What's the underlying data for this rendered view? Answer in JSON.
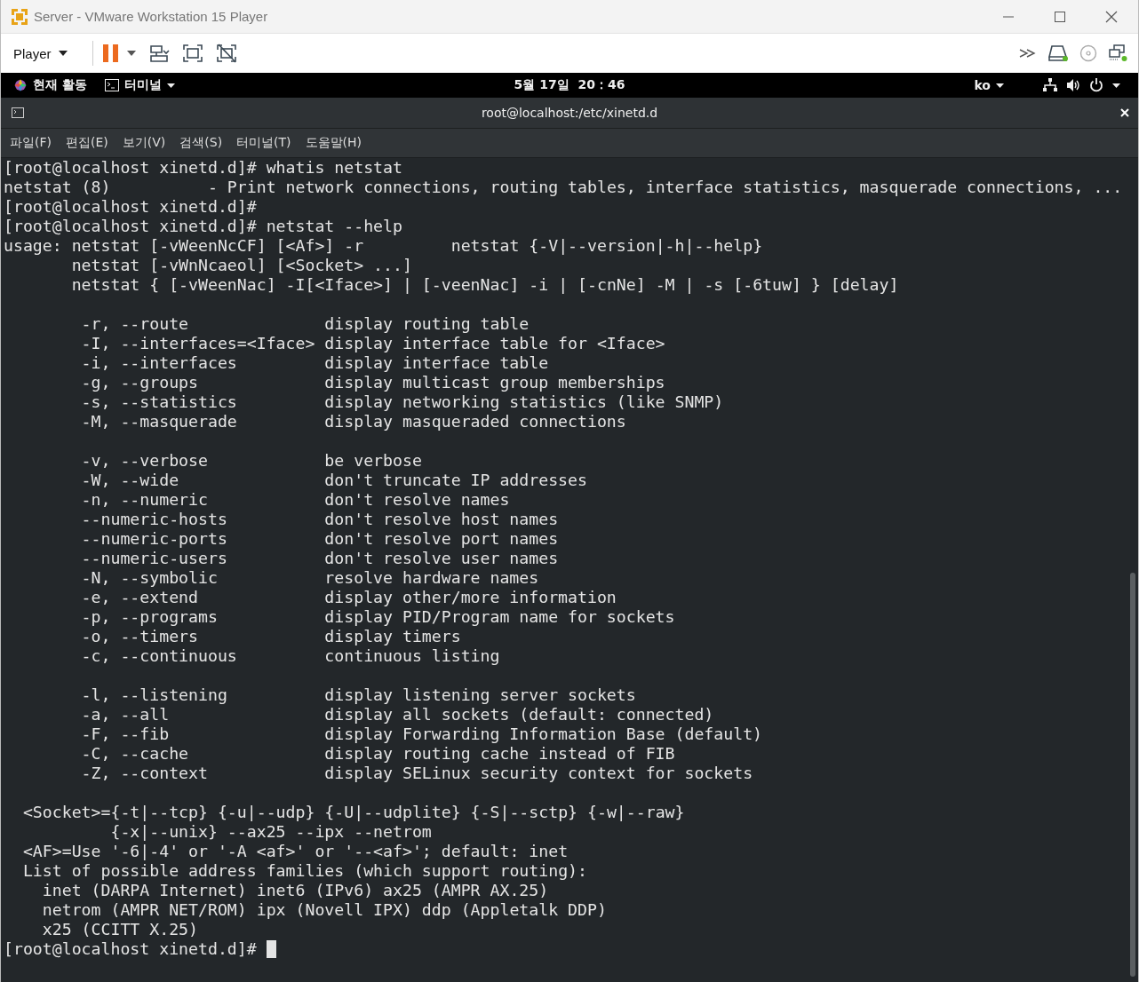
{
  "window": {
    "title": "Server - VMware Workstation 15 Player"
  },
  "toolbar": {
    "menu_label": "Player"
  },
  "top_bar": {
    "activities": "현재 활동",
    "app_menu": "터미널",
    "clock": "5월 17일  20：46",
    "input_method": "ko"
  },
  "terminal": {
    "title": "root@localhost:/etc/xinetd.d",
    "menu": [
      "파일(F)",
      "편집(E)",
      "보기(V)",
      "검색(S)",
      "터미널(T)",
      "도움말(H)"
    ],
    "blocks": [
      {
        "kind": "text",
        "lines": [
          "[root@localhost xinetd.d]# whatis netstat",
          "netstat (8)          - Print network connections, routing tables, interface statistics, masquerade connections, ...",
          "[root@localhost xinetd.d]#",
          "[root@localhost xinetd.d]# netstat --help",
          "usage: netstat [-vWeenNcCF] [<Af>] -r         netstat {-V|--version|-h|--help}",
          "       netstat [-vWnNcaeol] [<Socket> ...]",
          "       netstat { [-vWeenNac] -I[<Iface>] | [-veenNac] -i | [-cnNe] -M | -s [-6tuw] } [delay]"
        ]
      },
      {
        "kind": "options",
        "rows": [
          {
            "flag": "-r, --route",
            "desc": "display routing table"
          },
          {
            "flag": "-I, --interfaces=<Iface>",
            "desc": "display interface table for <Iface>"
          },
          {
            "flag": "-i, --interfaces",
            "desc": "display interface table"
          },
          {
            "flag": "-g, --groups",
            "desc": "display multicast group memberships"
          },
          {
            "flag": "-s, --statistics",
            "desc": "display networking statistics (like SNMP)"
          },
          {
            "flag": "-M, --masquerade",
            "desc": "display masqueraded connections"
          }
        ]
      },
      {
        "kind": "options",
        "rows": [
          {
            "flag": "-v, --verbose",
            "desc": "be verbose"
          },
          {
            "flag": "-W, --wide",
            "desc": "don't truncate IP addresses"
          },
          {
            "flag": "-n, --numeric",
            "desc": "don't resolve names"
          },
          {
            "flag": "--numeric-hosts",
            "desc": "don't resolve host names"
          },
          {
            "flag": "--numeric-ports",
            "desc": "don't resolve port names"
          },
          {
            "flag": "--numeric-users",
            "desc": "don't resolve user names"
          },
          {
            "flag": "-N, --symbolic",
            "desc": "resolve hardware names"
          },
          {
            "flag": "-e, --extend",
            "desc": "display other/more information"
          },
          {
            "flag": "-p, --programs",
            "desc": "display PID/Program name for sockets"
          },
          {
            "flag": "-o, --timers",
            "desc": "display timers"
          },
          {
            "flag": "-c, --continuous",
            "desc": "continuous listing"
          }
        ]
      },
      {
        "kind": "options",
        "rows": [
          {
            "flag": "-l, --listening",
            "desc": "display listening server sockets"
          },
          {
            "flag": "-a, --all",
            "desc": "display all sockets (default: connected)"
          },
          {
            "flag": "-F, --fib",
            "desc": "display Forwarding Information Base (default)"
          },
          {
            "flag": "-C, --cache",
            "desc": "display routing cache instead of FIB"
          },
          {
            "flag": "-Z, --context",
            "desc": "display SELinux security context for sockets"
          }
        ]
      },
      {
        "kind": "text",
        "lines": [
          "  <Socket>={-t|--tcp} {-u|--udp} {-U|--udplite} {-S|--sctp} {-w|--raw}",
          "           {-x|--unix} --ax25 --ipx --netrom",
          "  <AF>=Use '-6|-4' or '-A <af>' or '--<af>'; default: inet",
          "  List of possible address families (which support routing):",
          "    inet (DARPA Internet) inet6 (IPv6) ax25 (AMPR AX.25)",
          "    netrom (AMPR NET/ROM) ipx (Novell IPX) ddp (Appletalk DDP)",
          "    x25 (CCITT X.25)"
        ]
      }
    ],
    "prompt": "[root@localhost xinetd.d]# ",
    "cursor_visible": true
  }
}
